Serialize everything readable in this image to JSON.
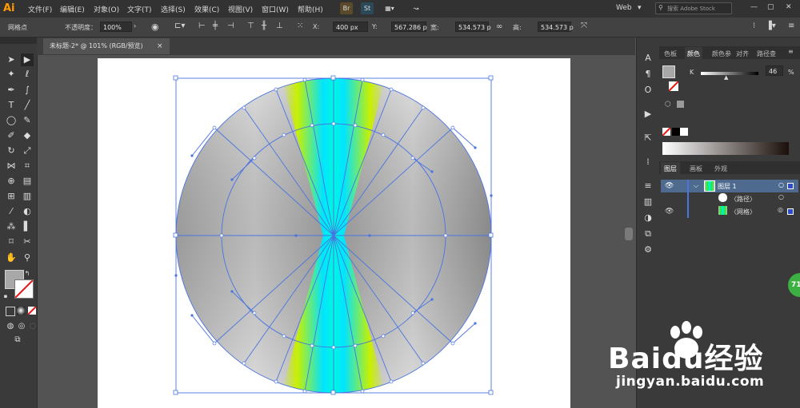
{
  "app": {
    "logo": "Ai",
    "menu": [
      "文件(F)",
      "编辑(E)",
      "对象(O)",
      "文字(T)",
      "选择(S)",
      "效果(C)",
      "视图(V)",
      "窗口(W)",
      "帮助(H)"
    ],
    "bridge_label": "Br",
    "stock_label": "St",
    "workspace": "Web",
    "search_placeholder": "搜索 Adobe Stock"
  },
  "control_bar": {
    "object_type": "网格点",
    "opacity_label": "不透明度：",
    "opacity_value": "100%",
    "x_label": "X:",
    "x_value": "400 px",
    "y_label": "Y:",
    "y_value": "567.286 p",
    "width_label": "宽:",
    "width_value": "534.573 p",
    "height_label": "高:",
    "height_value": "534.573 p"
  },
  "document": {
    "tab_title": "未标题-2* @ 101% (RGB/预览)",
    "close": "×"
  },
  "color_panel": {
    "tabs": [
      "色板",
      "颜色",
      "颜色参",
      "对齐",
      "路径查"
    ],
    "channel_label": "K",
    "channel_value": "46",
    "unit": "%"
  },
  "layers_panel": {
    "tabs": [
      "图层",
      "画板",
      "外观"
    ],
    "rows": [
      {
        "name": "图层 1"
      },
      {
        "name": "〈路径〉"
      },
      {
        "name": "〈网格〉"
      }
    ]
  },
  "watermark": {
    "brand": "Baidu经验",
    "url": "jingyan.baidu.com"
  },
  "badge": "71",
  "colors": {
    "menu_bg": "#323232",
    "control_bg": "#424242",
    "canvas_bg": "#535353",
    "selection_blue": "#4a74e0",
    "gradient_cyan": "#00f0f0",
    "gradient_yellow": "#c8f000",
    "metal_grey": "#b4b4b4"
  }
}
